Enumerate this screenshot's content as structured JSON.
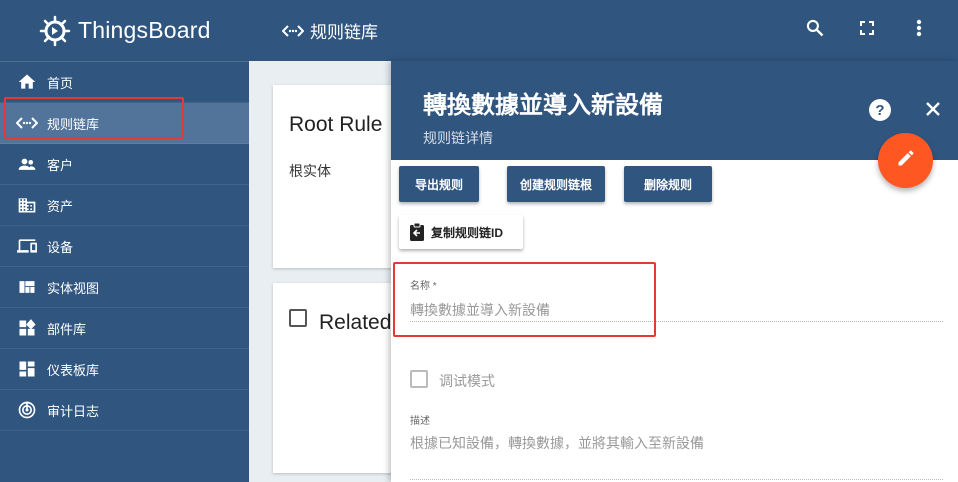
{
  "app": {
    "name": "ThingsBoard"
  },
  "sidebar": {
    "items": [
      {
        "label": "首页",
        "icon": "home-icon"
      },
      {
        "label": "规则链库",
        "icon": "rule-chain-icon"
      },
      {
        "label": "客户",
        "icon": "customers-icon"
      },
      {
        "label": "资产",
        "icon": "assets-icon"
      },
      {
        "label": "设备",
        "icon": "devices-icon"
      },
      {
        "label": "实体视图",
        "icon": "entity-view-icon"
      },
      {
        "label": "部件库",
        "icon": "widgets-icon"
      },
      {
        "label": "仪表板库",
        "icon": "dashboards-icon"
      },
      {
        "label": "审计日志",
        "icon": "audit-log-icon"
      }
    ],
    "active_index": 1
  },
  "topbar": {
    "breadcrumb": "规则链库",
    "search_icon": "search-icon",
    "fullscreen_icon": "fullscreen-icon",
    "menu_icon": "more-vert-icon"
  },
  "main": {
    "card_root": {
      "title": "Root Rule",
      "subtitle": "根实体"
    },
    "card_related": {
      "title": "Related"
    }
  },
  "panel": {
    "title": "轉換數據並導入新設備",
    "subtitle": "规则链详情",
    "help": "?",
    "buttons": {
      "export": "导出规则",
      "make_root": "创建规则链根",
      "delete": "删除规则",
      "copy_id": "复制规则链ID"
    },
    "name": {
      "label": "名称 *",
      "value": "轉換數據並導入新設備"
    },
    "debug": {
      "label": "调试模式"
    },
    "description": {
      "label": "描述",
      "value": "根據已知設備，轉換數據，並將其輸入至新設備"
    }
  },
  "colors": {
    "primary": "#305680",
    "accent": "#ff5722",
    "highlight": "#e53935"
  }
}
